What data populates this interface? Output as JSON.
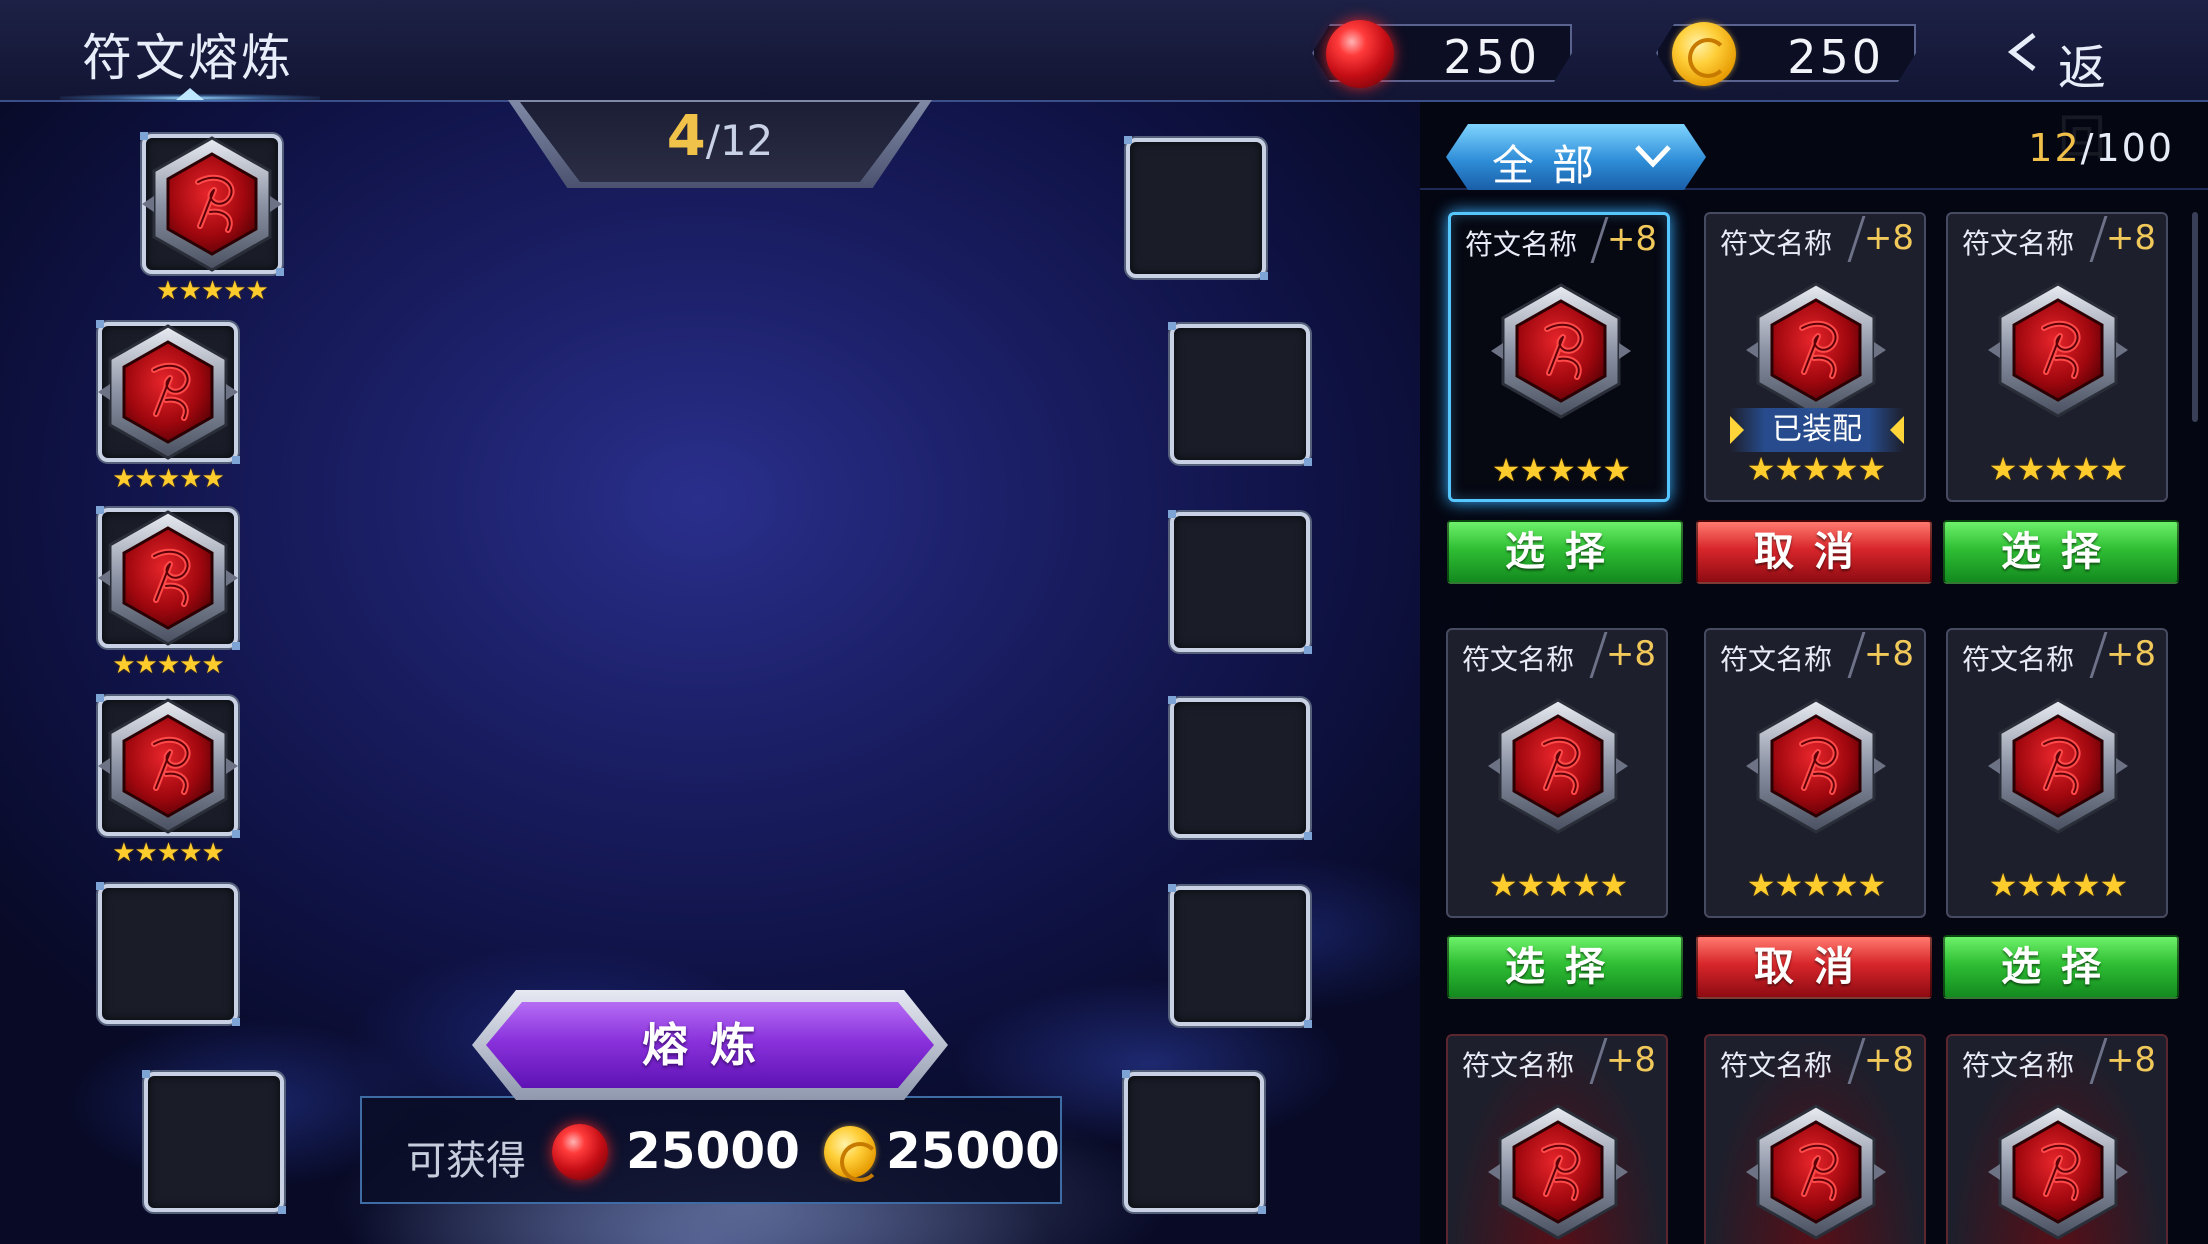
{
  "header": {
    "title": "符文熔炼",
    "gems": "250",
    "coins": "250",
    "back_label": "返回"
  },
  "counter": {
    "current": "4",
    "total": "/12"
  },
  "left_slots": [
    {
      "filled": true,
      "stars": "★★★★★"
    },
    {
      "filled": true,
      "stars": "★★★★★"
    },
    {
      "filled": true,
      "stars": "★★★★★"
    },
    {
      "filled": true,
      "stars": "★★★★★"
    },
    {
      "filled": false
    },
    {
      "filled": false
    }
  ],
  "smelt": {
    "button_label": "熔炼",
    "reward_label": "可获得",
    "reward_gems": "25000",
    "reward_coins": "25000"
  },
  "panel": {
    "filter_label": "全部",
    "capacity_current": "12",
    "capacity_max": "/100",
    "cards": [
      {
        "name": "符文名称",
        "level": "+8",
        "stars": "★★★★★",
        "equipped": "",
        "action": "选择",
        "selected": true
      },
      {
        "name": "符文名称",
        "level": "+8",
        "stars": "★★★★★",
        "equipped": "已装配",
        "action": "取消",
        "selected": false
      },
      {
        "name": "符文名称",
        "level": "+8",
        "stars": "★★★★★",
        "equipped": "",
        "action": "选择",
        "selected": false
      },
      {
        "name": "符文名称",
        "level": "+8",
        "stars": "★★★★★",
        "equipped": "",
        "action": "选择",
        "selected": false
      },
      {
        "name": "符文名称",
        "level": "+8",
        "stars": "★★★★★",
        "equipped": "",
        "action": "取消",
        "selected": false
      },
      {
        "name": "符文名称",
        "level": "+8",
        "stars": "★★★★★",
        "equipped": "",
        "action": "选择",
        "selected": false
      },
      {
        "name": "符文名称",
        "level": "+8"
      },
      {
        "name": "符文名称",
        "level": "+8"
      },
      {
        "name": "符文名称",
        "level": "+8"
      }
    ]
  },
  "colors": {
    "accent_gold": "#f1c24a",
    "select_green": "#2fbe34",
    "cancel_red": "#d8262b",
    "smelt_purple": "#8a32dc",
    "filter_blue": "#2f8ed8"
  }
}
